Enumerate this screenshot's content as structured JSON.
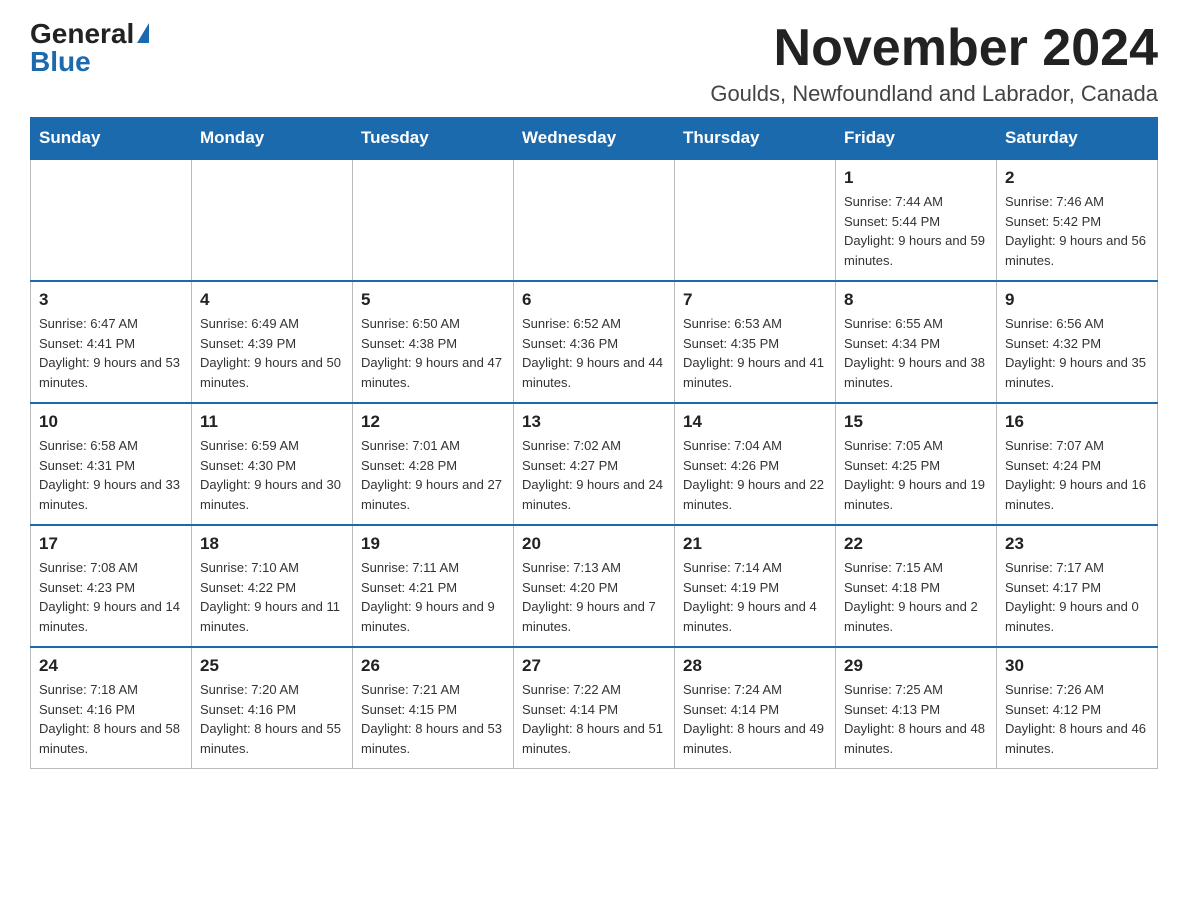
{
  "logo": {
    "text_general": "General",
    "text_blue": "Blue",
    "arrow": "▶"
  },
  "title": "November 2024",
  "subtitle": "Goulds, Newfoundland and Labrador, Canada",
  "days_of_week": [
    "Sunday",
    "Monday",
    "Tuesday",
    "Wednesday",
    "Thursday",
    "Friday",
    "Saturday"
  ],
  "weeks": [
    [
      {
        "day": "",
        "info": ""
      },
      {
        "day": "",
        "info": ""
      },
      {
        "day": "",
        "info": ""
      },
      {
        "day": "",
        "info": ""
      },
      {
        "day": "",
        "info": ""
      },
      {
        "day": "1",
        "info": "Sunrise: 7:44 AM\nSunset: 5:44 PM\nDaylight: 9 hours and 59 minutes."
      },
      {
        "day": "2",
        "info": "Sunrise: 7:46 AM\nSunset: 5:42 PM\nDaylight: 9 hours and 56 minutes."
      }
    ],
    [
      {
        "day": "3",
        "info": "Sunrise: 6:47 AM\nSunset: 4:41 PM\nDaylight: 9 hours and 53 minutes."
      },
      {
        "day": "4",
        "info": "Sunrise: 6:49 AM\nSunset: 4:39 PM\nDaylight: 9 hours and 50 minutes."
      },
      {
        "day": "5",
        "info": "Sunrise: 6:50 AM\nSunset: 4:38 PM\nDaylight: 9 hours and 47 minutes."
      },
      {
        "day": "6",
        "info": "Sunrise: 6:52 AM\nSunset: 4:36 PM\nDaylight: 9 hours and 44 minutes."
      },
      {
        "day": "7",
        "info": "Sunrise: 6:53 AM\nSunset: 4:35 PM\nDaylight: 9 hours and 41 minutes."
      },
      {
        "day": "8",
        "info": "Sunrise: 6:55 AM\nSunset: 4:34 PM\nDaylight: 9 hours and 38 minutes."
      },
      {
        "day": "9",
        "info": "Sunrise: 6:56 AM\nSunset: 4:32 PM\nDaylight: 9 hours and 35 minutes."
      }
    ],
    [
      {
        "day": "10",
        "info": "Sunrise: 6:58 AM\nSunset: 4:31 PM\nDaylight: 9 hours and 33 minutes."
      },
      {
        "day": "11",
        "info": "Sunrise: 6:59 AM\nSunset: 4:30 PM\nDaylight: 9 hours and 30 minutes."
      },
      {
        "day": "12",
        "info": "Sunrise: 7:01 AM\nSunset: 4:28 PM\nDaylight: 9 hours and 27 minutes."
      },
      {
        "day": "13",
        "info": "Sunrise: 7:02 AM\nSunset: 4:27 PM\nDaylight: 9 hours and 24 minutes."
      },
      {
        "day": "14",
        "info": "Sunrise: 7:04 AM\nSunset: 4:26 PM\nDaylight: 9 hours and 22 minutes."
      },
      {
        "day": "15",
        "info": "Sunrise: 7:05 AM\nSunset: 4:25 PM\nDaylight: 9 hours and 19 minutes."
      },
      {
        "day": "16",
        "info": "Sunrise: 7:07 AM\nSunset: 4:24 PM\nDaylight: 9 hours and 16 minutes."
      }
    ],
    [
      {
        "day": "17",
        "info": "Sunrise: 7:08 AM\nSunset: 4:23 PM\nDaylight: 9 hours and 14 minutes."
      },
      {
        "day": "18",
        "info": "Sunrise: 7:10 AM\nSunset: 4:22 PM\nDaylight: 9 hours and 11 minutes."
      },
      {
        "day": "19",
        "info": "Sunrise: 7:11 AM\nSunset: 4:21 PM\nDaylight: 9 hours and 9 minutes."
      },
      {
        "day": "20",
        "info": "Sunrise: 7:13 AM\nSunset: 4:20 PM\nDaylight: 9 hours and 7 minutes."
      },
      {
        "day": "21",
        "info": "Sunrise: 7:14 AM\nSunset: 4:19 PM\nDaylight: 9 hours and 4 minutes."
      },
      {
        "day": "22",
        "info": "Sunrise: 7:15 AM\nSunset: 4:18 PM\nDaylight: 9 hours and 2 minutes."
      },
      {
        "day": "23",
        "info": "Sunrise: 7:17 AM\nSunset: 4:17 PM\nDaylight: 9 hours and 0 minutes."
      }
    ],
    [
      {
        "day": "24",
        "info": "Sunrise: 7:18 AM\nSunset: 4:16 PM\nDaylight: 8 hours and 58 minutes."
      },
      {
        "day": "25",
        "info": "Sunrise: 7:20 AM\nSunset: 4:16 PM\nDaylight: 8 hours and 55 minutes."
      },
      {
        "day": "26",
        "info": "Sunrise: 7:21 AM\nSunset: 4:15 PM\nDaylight: 8 hours and 53 minutes."
      },
      {
        "day": "27",
        "info": "Sunrise: 7:22 AM\nSunset: 4:14 PM\nDaylight: 8 hours and 51 minutes."
      },
      {
        "day": "28",
        "info": "Sunrise: 7:24 AM\nSunset: 4:14 PM\nDaylight: 8 hours and 49 minutes."
      },
      {
        "day": "29",
        "info": "Sunrise: 7:25 AM\nSunset: 4:13 PM\nDaylight: 8 hours and 48 minutes."
      },
      {
        "day": "30",
        "info": "Sunrise: 7:26 AM\nSunset: 4:12 PM\nDaylight: 8 hours and 46 minutes."
      }
    ]
  ]
}
